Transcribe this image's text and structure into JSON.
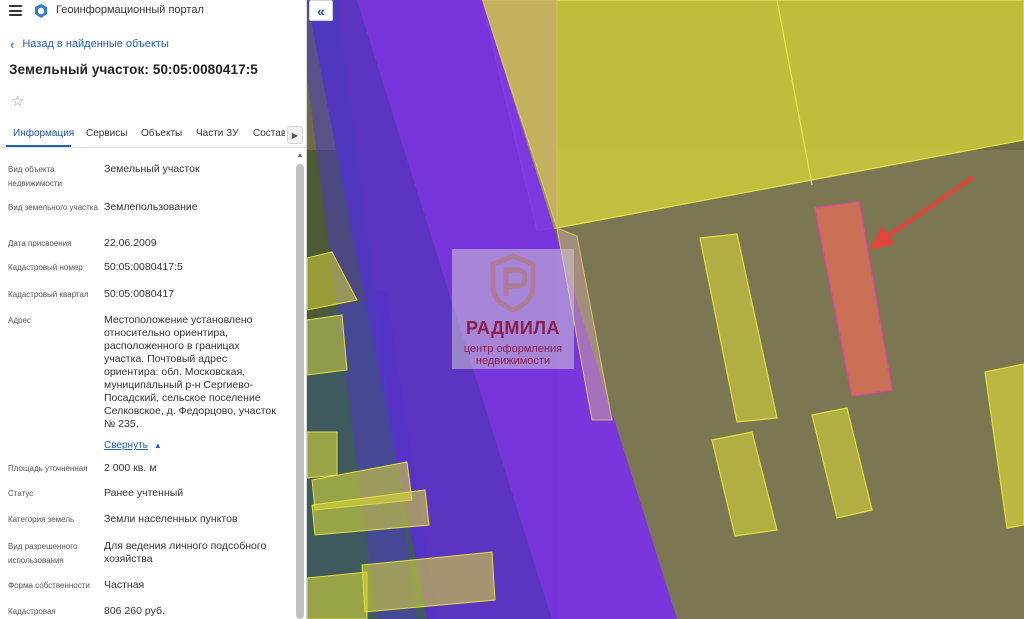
{
  "app": {
    "title": "Геоинформационный портал"
  },
  "nav": {
    "back_label": "Назад в найденные объекты"
  },
  "object": {
    "title": "Земельный участок: 50:05:0080417:5"
  },
  "tabs": [
    "Информация",
    "Сервисы",
    "Объекты",
    "Части ЗУ",
    "Состав"
  ],
  "properties": [
    {
      "label": "Вид объекта недвижимости",
      "value": "Земельный участок"
    },
    {
      "label": "Вид земельного участка",
      "value": "Землепользование"
    },
    {
      "label": "Дата присвоения",
      "value": "22.06.2009"
    },
    {
      "label": "Кадастровый номер",
      "value": "50:05:0080417:5"
    },
    {
      "label": "Кадастровый квартал",
      "value": "50:05:0080417"
    },
    {
      "label": "Адрес",
      "value": "Местоположение установлено относительно ориентира, расположенного в границах участка. Почтовый адрес ориентира: обл. Московская, муниципальный р-н Сергиево-Посадский, сельское поселение Селковское, д. Федорцово, участок № 235."
    },
    {
      "label": "Площадь уточненная",
      "value": "2 000 кв. м"
    },
    {
      "label": "Статус",
      "value": "Ранее учтенный"
    },
    {
      "label": "Категория земель",
      "value": "Земли населенных пунктов"
    },
    {
      "label": "Вид разрешенного использования",
      "value": "Для ведения личного подсобного хозяйства"
    },
    {
      "label": "Форма собственности",
      "value": "Частная"
    },
    {
      "label": "Кадастровая",
      "value": "806 260 руб."
    }
  ],
  "collapse_label": "Свернуть",
  "watermark": {
    "name": "РАДМИЛА",
    "line1": "центр оформления",
    "line2": "недвижимости"
  },
  "colors": {
    "accent": "#1f5fbf",
    "parcel_fill": "#d6d43a",
    "zone_fill": "#7a2cf0",
    "highlight_parcel": "#d86f55",
    "arrow": "#e0473a"
  },
  "icons": [
    "menu-icon",
    "portal-logo-icon",
    "chevron-left-icon",
    "star-icon",
    "chevron-right-icon",
    "chevron-up-icon",
    "double-chevron-left-icon",
    "arrow-icon"
  ]
}
